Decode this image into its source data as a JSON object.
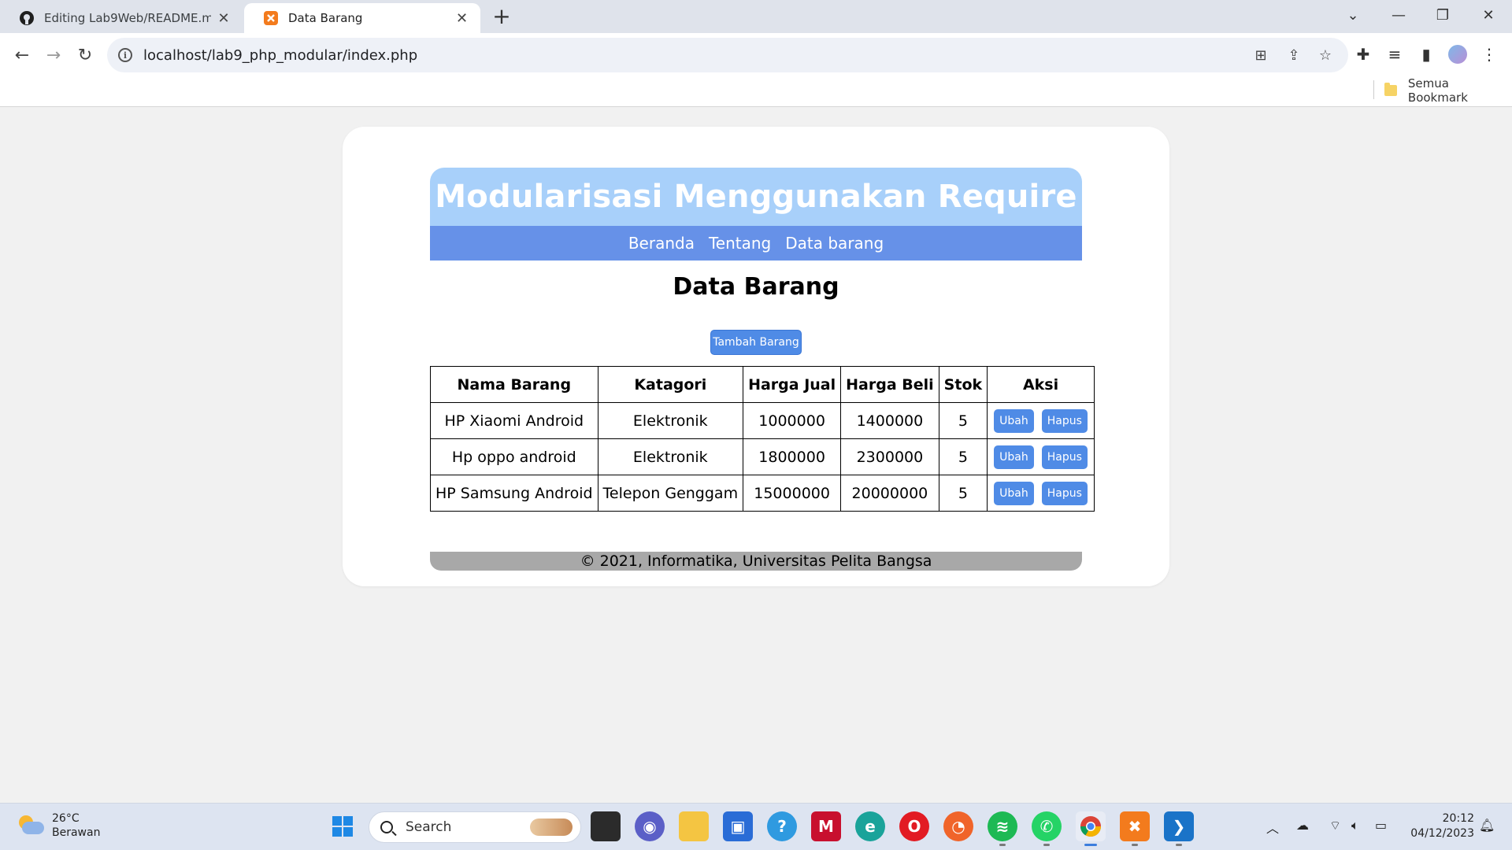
{
  "browser": {
    "tabs": [
      {
        "title": "Editing Lab9Web/README.md at",
        "active": false
      },
      {
        "title": "Data Barang",
        "active": true
      }
    ],
    "url": "localhost/lab9_php_modular/index.php",
    "bookmarks_all_label": "Semua Bookmark"
  },
  "page": {
    "header_title": "Modularisasi Menggunakan Require",
    "nav": [
      "Beranda",
      "Tentang",
      "Data barang"
    ],
    "title": "Data Barang",
    "add_button": "Tambah Barang",
    "table": {
      "columns": [
        "Nama Barang",
        "Katagori",
        "Harga Jual",
        "Harga Beli",
        "Stok",
        "Aksi"
      ],
      "rows": [
        {
          "nama": "HP Xiaomi Android",
          "kategori": "Elektronik",
          "harga_jual": "1000000",
          "harga_beli": "1400000",
          "stok": "5"
        },
        {
          "nama": "Hp oppo android",
          "kategori": "Elektronik",
          "harga_jual": "1800000",
          "harga_beli": "2300000",
          "stok": "5"
        },
        {
          "nama": "HP Samsung Android",
          "kategori": "Telepon Genggam",
          "harga_jual": "15000000",
          "harga_beli": "20000000",
          "stok": "5"
        }
      ],
      "edit_label": "Ubah",
      "delete_label": "Hapus"
    },
    "footer": "© 2021, Informatika, Universitas Pelita Bangsa"
  },
  "taskbar": {
    "weather_temp": "26°C",
    "weather_desc": "Berawan",
    "search_label": "Search",
    "time": "20:12",
    "date": "04/12/2023"
  },
  "colors": {
    "header_bg": "#a8d0fa",
    "nav_bg": "#6691e8",
    "button_bg": "#4f8be6",
    "footer_bg": "#a8a8a8"
  }
}
